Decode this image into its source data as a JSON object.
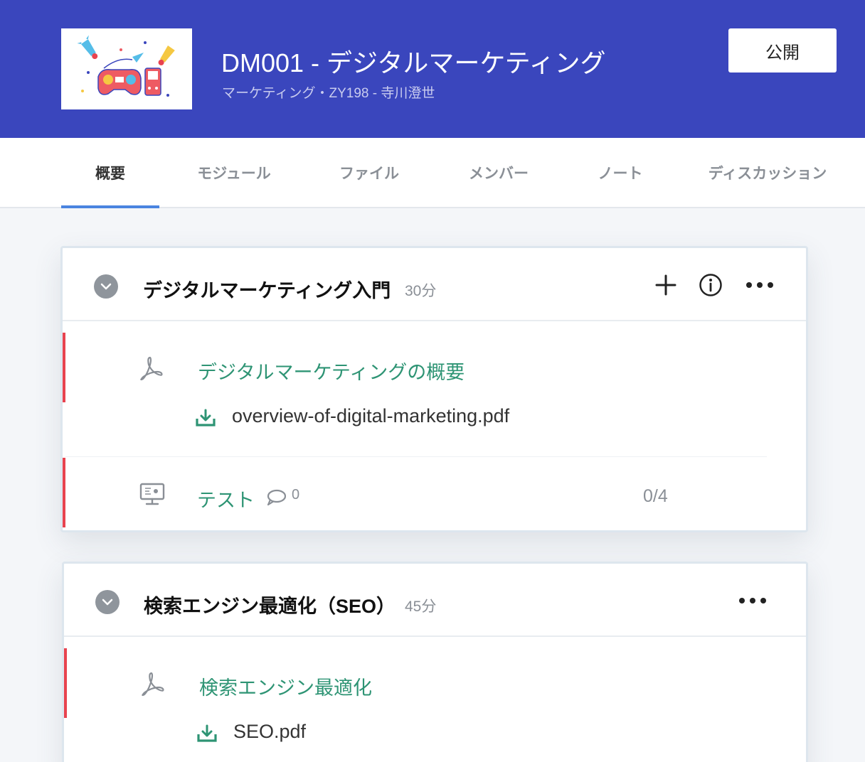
{
  "header": {
    "title": "DM001 - デジタルマーケティング",
    "subtitle": "マーケティング・ZY198 - 寺川澄世",
    "publish_label": "公開",
    "background_color": "#3a46bd"
  },
  "tabs": [
    {
      "label": "概要",
      "active": true
    },
    {
      "label": "モジュール",
      "active": false
    },
    {
      "label": "ファイル",
      "active": false
    },
    {
      "label": "メンバー",
      "active": false
    },
    {
      "label": "ノート",
      "active": false
    },
    {
      "label": "ディスカッション",
      "active": false
    }
  ],
  "sections": [
    {
      "title": "デジタルマーケティング入門",
      "duration": "30分",
      "actions": [
        "plus-icon",
        "info-icon",
        "more-icon"
      ],
      "lesson": {
        "icon": "pdf-icon",
        "title": "デジタルマーケティングの概要",
        "file": "overview-of-digital-marketing.pdf"
      },
      "quiz": {
        "icon": "monitor-icon",
        "title": "テスト",
        "comments": "0",
        "score": "0/4"
      }
    },
    {
      "title": "検索エンジン最適化（SEO）",
      "duration": "45分",
      "actions": [
        "more-icon"
      ],
      "lesson": {
        "icon": "pdf-icon",
        "title": "検索エンジン最適化",
        "file": "SEO.pdf"
      }
    }
  ],
  "colors": {
    "accent_green": "#2e9474",
    "status_red": "#e8434f",
    "tab_underline": "#4a84e0"
  }
}
